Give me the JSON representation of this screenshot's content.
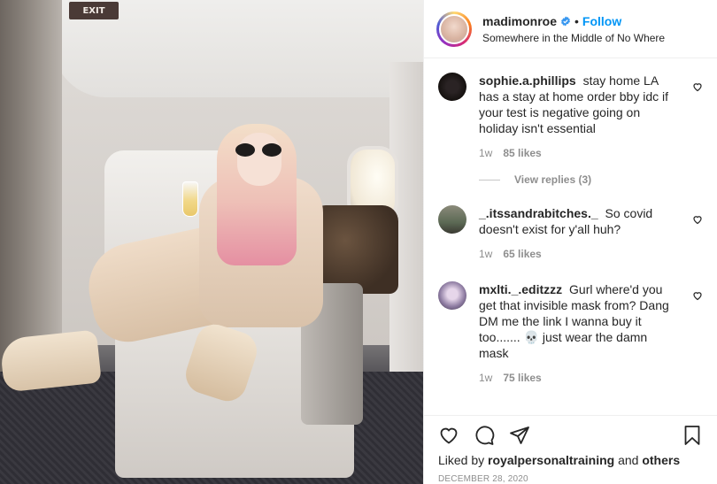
{
  "photo": {
    "exit_sign": "EXIT"
  },
  "header": {
    "username": "madimonroe",
    "verified_icon": "verified-badge-icon",
    "separator": "•",
    "follow_label": "Follow",
    "location": "Somewhere in the Middle of No Where"
  },
  "comments": [
    {
      "username": "sophie.a.phillips",
      "text": "stay home LA has a stay at home order bby idc if your test is negative going on holiday isn't essential",
      "time": "1w",
      "likes": "85 likes",
      "replies_label": "View replies (3)"
    },
    {
      "username": "_.itssandrabitches._",
      "text": "So covid doesn't exist for y'all huh?",
      "time": "1w",
      "likes": "65 likes"
    },
    {
      "username": "mxlti._.editzzz",
      "text": "Gurl where'd you get that invisible mask from? Dang DM me the link I wanna buy it too....... 💀 just wear the damn mask",
      "time": "1w",
      "likes": "75 likes"
    }
  ],
  "actions": {
    "like_icon": "heart-icon",
    "comment_icon": "comment-icon",
    "share_icon": "share-icon",
    "save_icon": "bookmark-icon",
    "liked_by_prefix": "Liked by",
    "liked_by_user": "royalpersonaltraining",
    "liked_by_and": "and",
    "liked_by_others": "others",
    "date": "DECEMBER 28, 2020"
  },
  "colors": {
    "accent": "#0095f6",
    "text": "#262626",
    "muted": "#8e8e8e"
  }
}
